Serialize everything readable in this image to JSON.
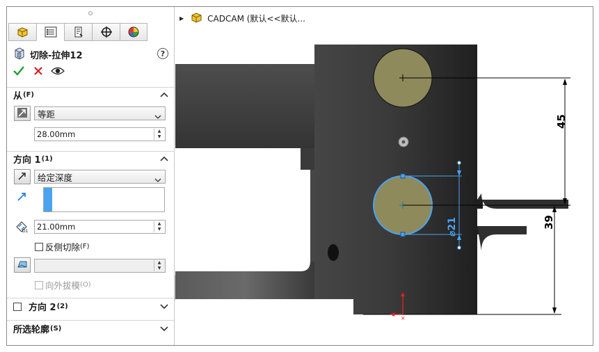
{
  "panel": {
    "tabs": [
      "feature-manager",
      "property-manager",
      "configuration-manager",
      "dimxpert-manager",
      "display-manager"
    ],
    "title": "切除-拉伸12",
    "help_label": "?",
    "from_section": {
      "label": "从",
      "shortcut": "(F)",
      "start_condition": "等距",
      "offset_value": "28.00mm"
    },
    "direction1_section": {
      "label": "方向 1",
      "shortcut": "(1)",
      "end_condition": "给定深度",
      "depth_value": "21.00mm",
      "depth_icon_label": "D1",
      "flip_side_label": "反侧切除",
      "flip_side_shortcut": "(F)",
      "draft_value": "",
      "draft_outward_label": "向外拔模",
      "draft_outward_shortcut": "(O)"
    },
    "direction2_section": {
      "label": "方向 2",
      "shortcut": "(2)"
    },
    "selected_contours_section": {
      "label": "所选轮廓",
      "shortcut": "(S)"
    }
  },
  "viewport": {
    "breadcrumb": "CADCAM  (默认<<默认..."
  },
  "dimensions": {
    "vertical_top": "45",
    "vertical_bottom": "39",
    "diameter": "⌀21"
  },
  "colors": {
    "accept": "#22a02a",
    "cancel": "#d42020",
    "sketch_fill": "#8f8a5c",
    "selection_blue": "#4aa3f0",
    "part_dark": "#3c3c3c"
  }
}
